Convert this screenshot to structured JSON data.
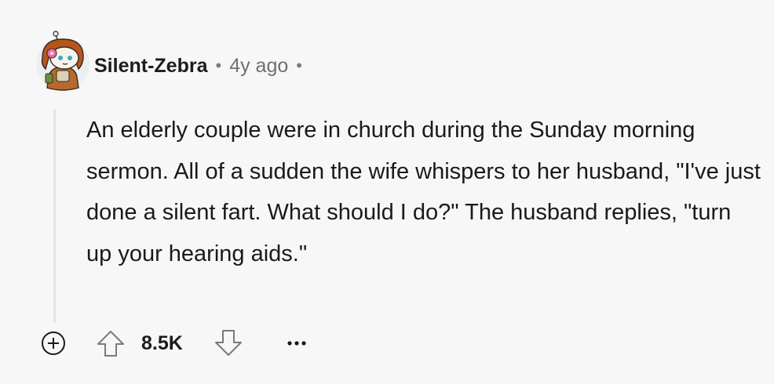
{
  "comment": {
    "author": "Silent-Zebra",
    "separator": "•",
    "age": "4y ago",
    "body": "An elderly couple were in church during the Sunday morning sermon. All of a sudden the wife whispers to her husband, \"I've just done a silent fart. What should I do?\" The husband replies, \"turn up your hearing aids.\"",
    "score": "8.5K"
  },
  "icons": {
    "avatar": "snoo-avatar",
    "expand": "plus-circle-icon",
    "upvote": "arrow-up-icon",
    "downvote": "arrow-down-icon",
    "more": "ellipsis-icon"
  },
  "colors": {
    "background": "#f7f7f8",
    "text": "#1a1a1b",
    "muted": "#6f6f73",
    "thread_line": "#e3e3e6"
  }
}
